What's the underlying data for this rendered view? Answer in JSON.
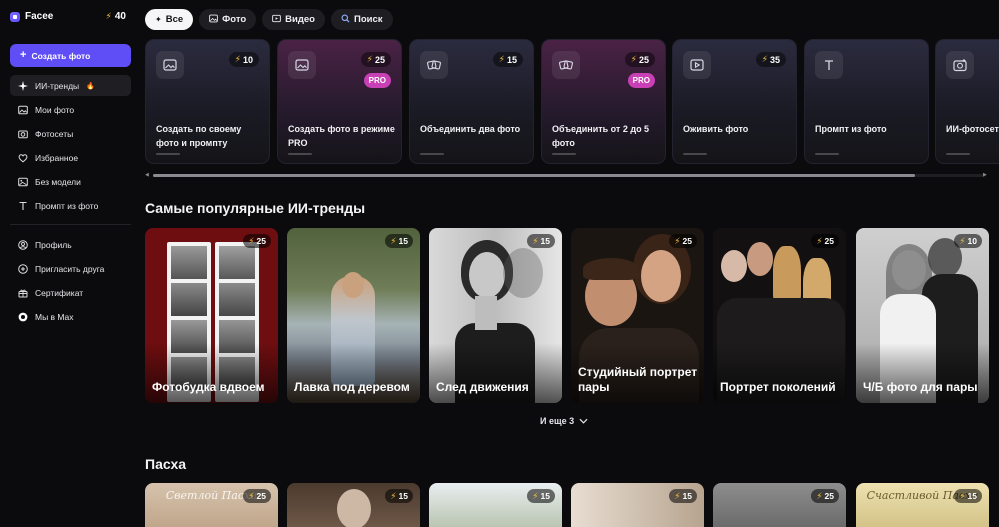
{
  "app": {
    "name": "Facee",
    "credits": "40"
  },
  "sidebar": {
    "create_label": "Создать фото",
    "items": [
      {
        "label": "ИИ-тренды",
        "icon": "sparkle-icon",
        "active": true,
        "emoji": "🔥"
      },
      {
        "label": "Мои фото",
        "icon": "image-icon"
      },
      {
        "label": "Фотосеты",
        "icon": "camera-icon"
      },
      {
        "label": "Избранное",
        "icon": "heart-icon"
      },
      {
        "label": "Без модели",
        "icon": "gallery-icon"
      },
      {
        "label": "Промпт из фото",
        "icon": "text-icon"
      }
    ],
    "items2": [
      {
        "label": "Профиль",
        "icon": "user-icon"
      },
      {
        "label": "Пригласить друга",
        "icon": "invite-icon"
      },
      {
        "label": "Сертификат",
        "icon": "gift-icon"
      },
      {
        "label": "Мы в Max",
        "icon": "chat-icon"
      }
    ]
  },
  "tabs": [
    {
      "label": "Все",
      "icon": "sparkle-icon",
      "active": true
    },
    {
      "label": "Фото",
      "icon": "image-icon"
    },
    {
      "label": "Видео",
      "icon": "video-icon"
    },
    {
      "label": "Поиск",
      "icon": "search-icon"
    }
  ],
  "tools": [
    {
      "title": "Создать по своему фото и промпту",
      "cost": "10",
      "icon": "image-icon",
      "pro": false
    },
    {
      "title": "Создать фото в режиме PRO",
      "cost": "25",
      "icon": "image-icon",
      "pro": true
    },
    {
      "title": "Объединить два фото",
      "cost": "15",
      "icon": "merge-icon",
      "pro": false
    },
    {
      "title": "Объединить от 2 до 5 фото",
      "cost": "25",
      "icon": "merge-icon",
      "pro": true
    },
    {
      "title": "Оживить фото",
      "cost": "35",
      "icon": "video-icon",
      "pro": false
    },
    {
      "title": "Промпт из фото",
      "cost": "",
      "icon": "text-icon",
      "pro": false
    },
    {
      "title": "ИИ-фотосет",
      "cost": "",
      "icon": "camera-icon",
      "pro": false
    }
  ],
  "pro_label": "PRO",
  "trends": {
    "title": "Самые популярные ИИ-тренды",
    "items": [
      {
        "title": "Фотобудка вдвоем",
        "cost": "25"
      },
      {
        "title": "Лавка под деревом",
        "cost": "15"
      },
      {
        "title": "След движения",
        "cost": "15"
      },
      {
        "title": "Студийный портрет пары",
        "cost": "25"
      },
      {
        "title": "Портрет поколений",
        "cost": "25"
      },
      {
        "title": "Ч/Б фото для пары",
        "cost": "10"
      }
    ],
    "more_label": "И еще 3"
  },
  "easter": {
    "title": "Пасха",
    "items": [
      {
        "cost": "25",
        "script": "Светлой Пасхи"
      },
      {
        "cost": "15",
        "script": ""
      },
      {
        "cost": "15",
        "script": ""
      },
      {
        "cost": "15",
        "script": ""
      },
      {
        "cost": "25",
        "script": ""
      },
      {
        "cost": "15",
        "script": "Счастливой Пасхи"
      }
    ]
  },
  "colors": {
    "accent": "#5f4df6",
    "pro": "#c93fb5",
    "bolt": "#f5c542"
  }
}
